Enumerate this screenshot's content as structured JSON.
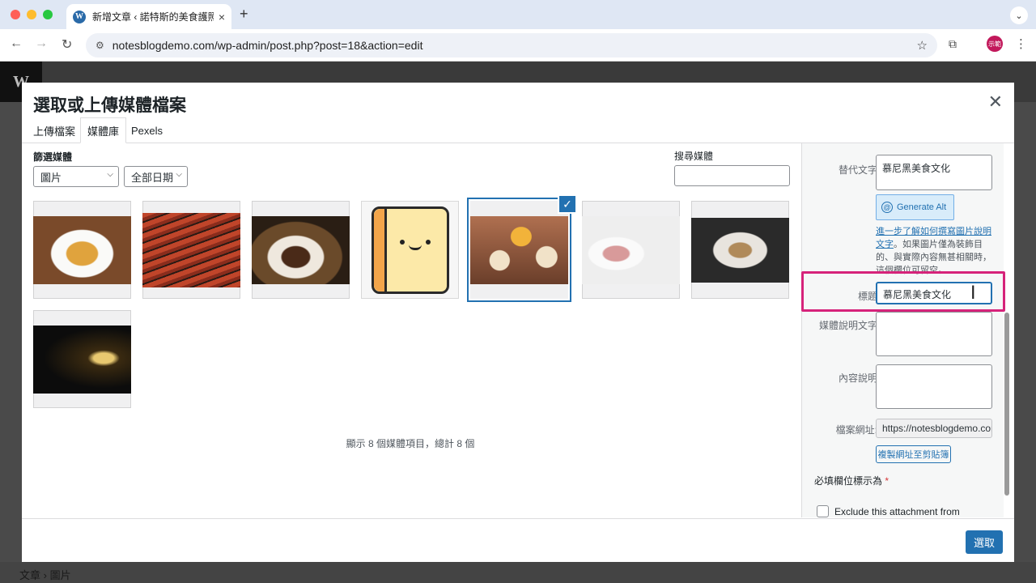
{
  "browser": {
    "tab_title": "新增文章 ‹ 諾特斯的美食護照 —",
    "url": "notesblogdemo.com/wp-admin/post.php?post=18&action=edit",
    "profile_initials": "示範"
  },
  "modal": {
    "title": "選取或上傳媒體檔案",
    "tabs": [
      {
        "label": "上傳檔案"
      },
      {
        "label": "媒體庫",
        "active": true
      },
      {
        "label": "Pexels"
      }
    ],
    "filter_label": "篩選媒體",
    "type_select": "圖片",
    "date_select": "全部日期",
    "search_label": "搜尋媒體",
    "search_value": "",
    "count_text": "顯示 8 個媒體項目，總計 8 個",
    "media": [
      {
        "icon": "fried-cutlet-image"
      },
      {
        "icon": "sausages-grill-image"
      },
      {
        "icon": "pork-knuckle-image"
      },
      {
        "icon": "cartoon-notepad-image"
      },
      {
        "icon": "toast-cheers-image",
        "selected": true
      },
      {
        "icon": "cold-cuts-image"
      },
      {
        "icon": "seafood-plate-image"
      },
      {
        "icon": "beer-glass-image"
      }
    ],
    "select_button": "選取"
  },
  "details": {
    "alt_label": "替代文字",
    "alt_value": "慕尼黑美食文化",
    "generate_alt": "Generate Alt",
    "help_link": "進一步了解如何撰寫圖片說明文字",
    "help_text": "。如果圖片僅為裝飾目的、與實際內容無甚相關時，這個欄位可留空。",
    "title_label": "標題",
    "title_value": "慕尼黑美食文化",
    "caption_label": "媒體說明文字",
    "caption_value": "",
    "description_label": "內容說明",
    "description_value": "",
    "file_url_label": "檔案網址:",
    "file_url_value": "https://notesblogdemo.com",
    "copy_button": "複製網址至剪貼簿",
    "required_note": "必填欄位標示為",
    "required_star": "*",
    "exclude_label": "Exclude this attachment from"
  },
  "page": {
    "breadcrumb": [
      "文章",
      "圖片"
    ]
  },
  "colors": {
    "accent": "#2271b1",
    "highlight": "#d6237a"
  }
}
